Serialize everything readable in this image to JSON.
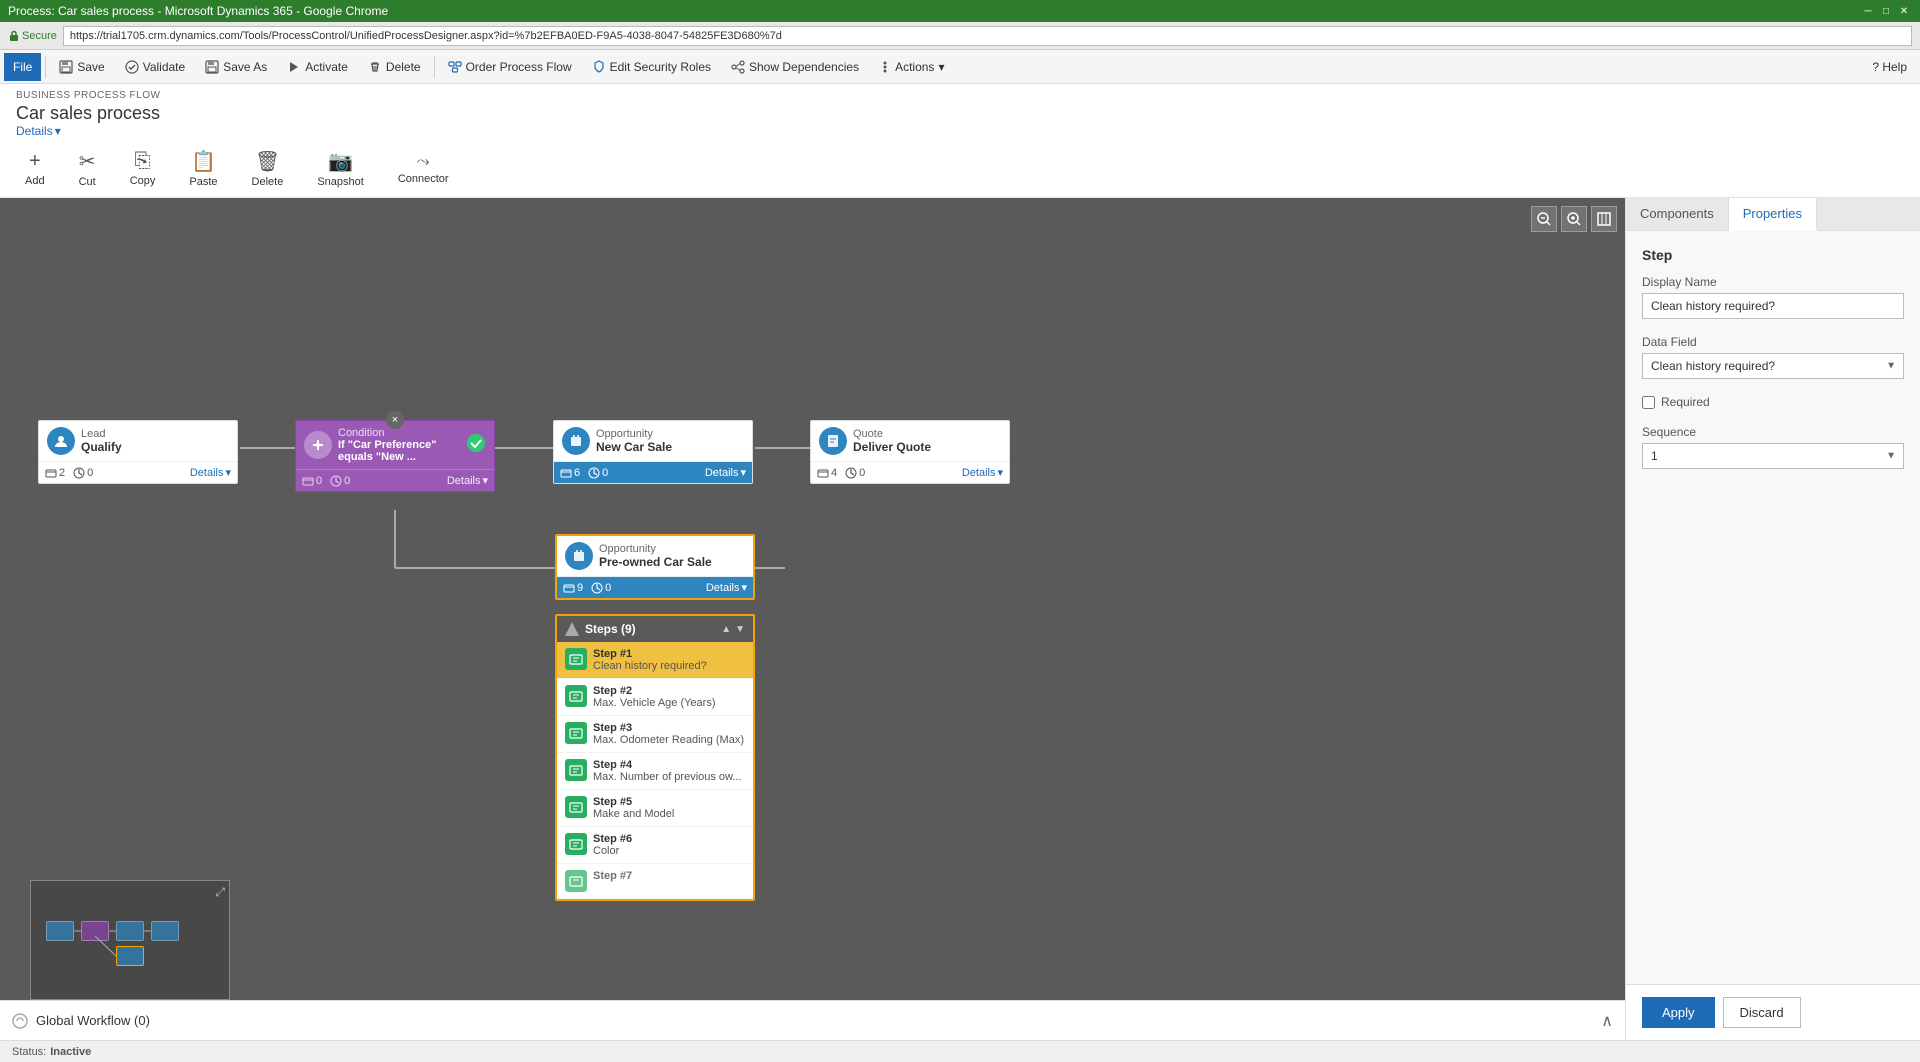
{
  "titleBar": {
    "text": "Process: Car sales process - Microsoft Dynamics 365 - Google Chrome",
    "minimize": "─",
    "maximize": "□",
    "close": "✕"
  },
  "addressBar": {
    "secure": "Secure",
    "url": "https://trial1705.crm.dynamics.com/Tools/ProcessControl/UnifiedProcessDesigner.aspx?id=%7b2EFBA0ED-F9A5-4038-8047-54825FE3D680%7d"
  },
  "topToolbar": {
    "file": "File",
    "save": "Save",
    "validate": "Validate",
    "saveAs": "Save As",
    "activate": "Activate",
    "delete": "Delete",
    "orderProcessFlow": "Order Process Flow",
    "editSecurityRoles": "Edit Security Roles",
    "showDependencies": "Show Dependencies",
    "actions": "Actions",
    "help": "? Help"
  },
  "breadcrumb": {
    "label": "BUSINESS PROCESS FLOW",
    "title": "Car sales process",
    "details": "Details"
  },
  "editToolbar": {
    "add": "Add",
    "cut": "Cut",
    "copy": "Copy",
    "paste": "Paste",
    "delete": "Delete",
    "snapshot": "Snapshot",
    "connector": "Connector"
  },
  "nodes": {
    "lead": {
      "type": "Lead",
      "subtitle": "Qualify",
      "counter1": "2",
      "counter2": "0",
      "details": "Details"
    },
    "condition": {
      "type": "Condition",
      "subtitle": "If \"Car Preference\" equals \"New ...",
      "counter1": "0",
      "counter2": "0",
      "details": "Details",
      "closeBtn": "×"
    },
    "opportunityNew": {
      "type": "Opportunity",
      "subtitle": "New Car Sale",
      "counter1": "6",
      "counter2": "0",
      "details": "Details"
    },
    "quote": {
      "type": "Quote",
      "subtitle": "Deliver Quote",
      "counter1": "4",
      "counter2": "0",
      "details": "Details"
    },
    "opportunityPreowned": {
      "type": "Opportunity",
      "subtitle": "Pre-owned Car Sale",
      "counter1": "9",
      "counter2": "0",
      "details": "Details"
    }
  },
  "stepsPanel": {
    "title": "Steps (9)",
    "steps": [
      {
        "number": "Step #1",
        "desc": "Clean history required?"
      },
      {
        "number": "Step #2",
        "desc": "Max. Vehicle Age (Years)"
      },
      {
        "number": "Step #3",
        "desc": "Max. Odometer Reading (Max)"
      },
      {
        "number": "Step #4",
        "desc": "Max. Number of previous ow..."
      },
      {
        "number": "Step #5",
        "desc": "Make and Model"
      },
      {
        "number": "Step #6",
        "desc": "Color"
      },
      {
        "number": "Step #7",
        "desc": "Step #7"
      }
    ]
  },
  "rightPanel": {
    "tabs": {
      "components": "Components",
      "properties": "Properties"
    },
    "step": {
      "sectionTitle": "Step",
      "displayNameLabel": "Display Name",
      "displayNameValue": "Clean history required?",
      "dataFieldLabel": "Data Field",
      "dataFieldValue": "Clean history required?",
      "requiredLabel": "Required",
      "sequenceLabel": "Sequence",
      "sequenceValue": "1"
    }
  },
  "buttons": {
    "apply": "Apply",
    "discard": "Discard"
  },
  "globalWorkflow": {
    "label": "Global Workflow (0)"
  },
  "statusBar": {
    "status": "Status:",
    "value": "Inactive"
  }
}
